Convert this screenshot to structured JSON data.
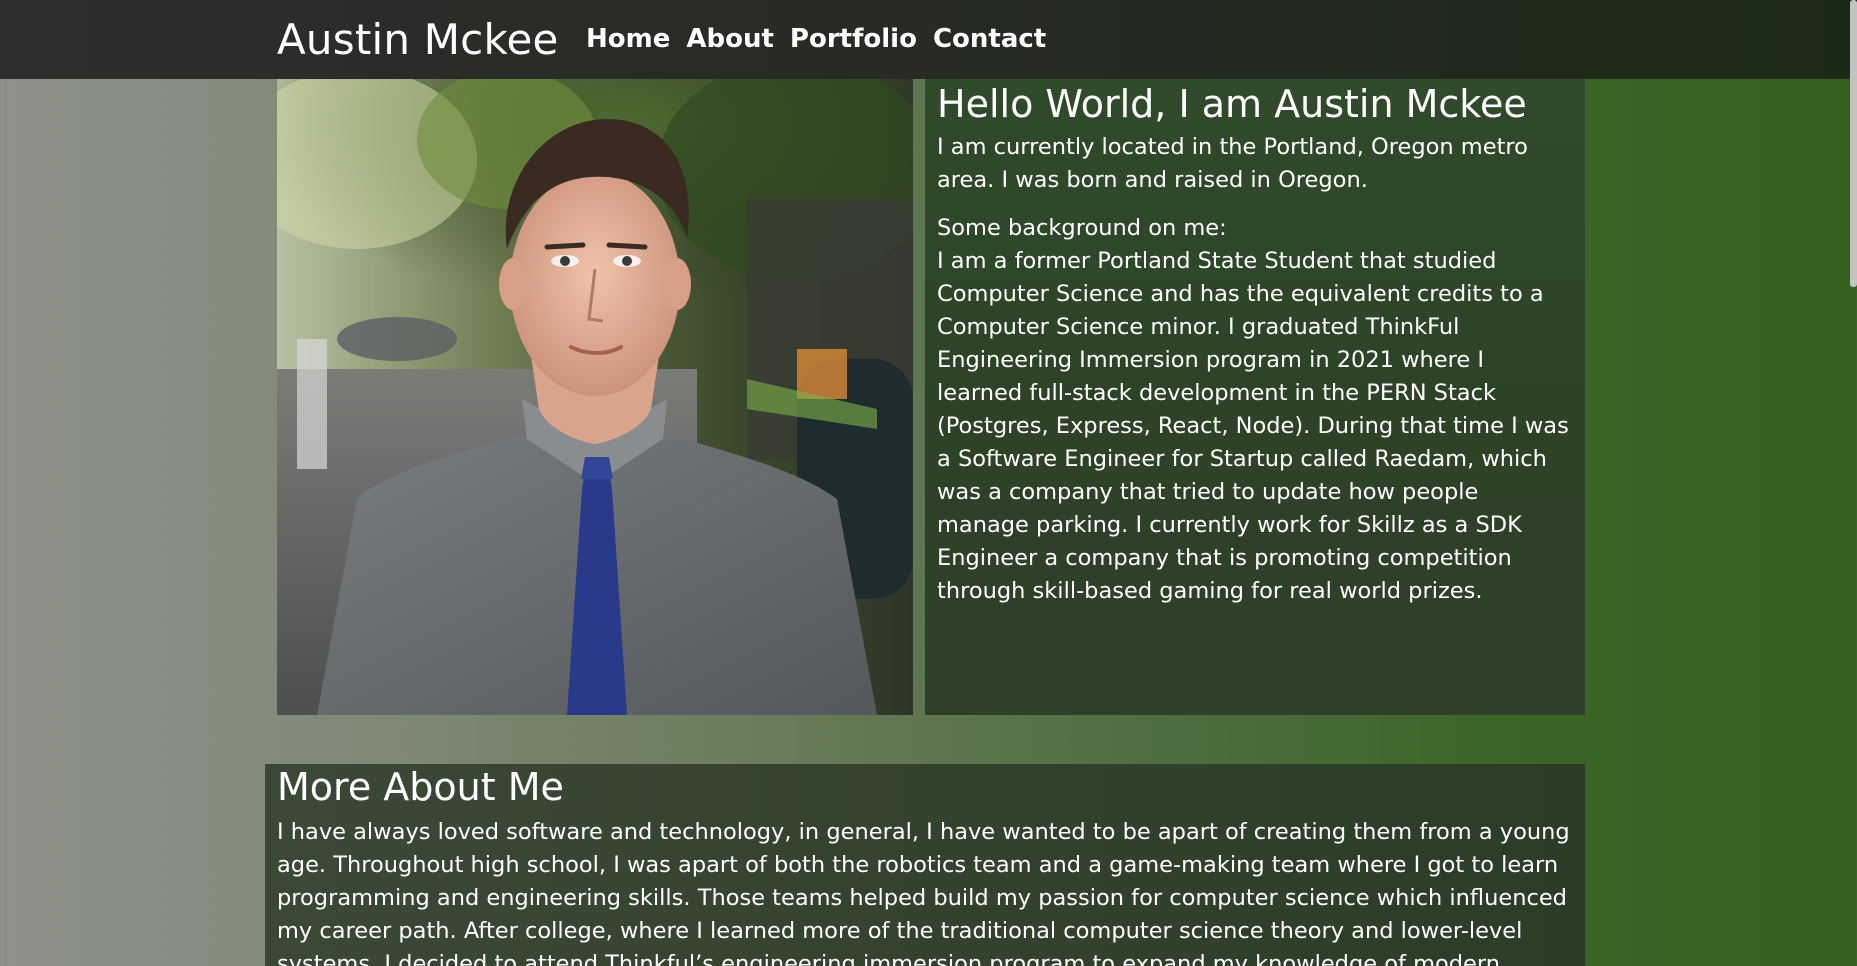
{
  "header": {
    "brand": "Austin Mckee",
    "nav": [
      {
        "label": "Home"
      },
      {
        "label": "About"
      },
      {
        "label": "Portfolio"
      },
      {
        "label": "Contact"
      }
    ]
  },
  "intro": {
    "title": "Hello World, I am Austin Mckee",
    "paragraph1": "I am currently located in the Portland, Oregon metro area. I was born and raised in Oregon.",
    "paragraph2_heading": "Some background on me:",
    "paragraph2": "I am a former Portland State Student that studied Computer Science and has the equivalent credits to a Computer Science minor. I graduated ThinkFul Engineering Immersion program in 2021 where I learned full-stack development in the PERN Stack (Postgres, Express, React, Node). During that time I was a Software Engineer for Startup called Raedam, which was a company that tried to update how people manage parking. I currently work for Skillz as a SDK Engineer a company that is promoting competition through skill-based gaming for real world prizes."
  },
  "more": {
    "title": "More About Me",
    "paragraph": "I have always loved software and technology, in general, I have wanted to be apart of creating them from a young age. Throughout high school, I was apart of both the robotics team and a game-making team where I got to learn programming and engineering skills. Those teams helped build my passion for computer science which influenced my career path. After college, where I learned more of the traditional computer science theory and lower-level systems, I decided to attend Thinkful’s engineering immersion program to expand my knowledge of modern"
  },
  "colors": {
    "header_bg": "#272a25",
    "panel_bg": "#2f4529",
    "text": "#ffffff",
    "shirt": "#6e7174",
    "tie": "#2a3a8a"
  }
}
